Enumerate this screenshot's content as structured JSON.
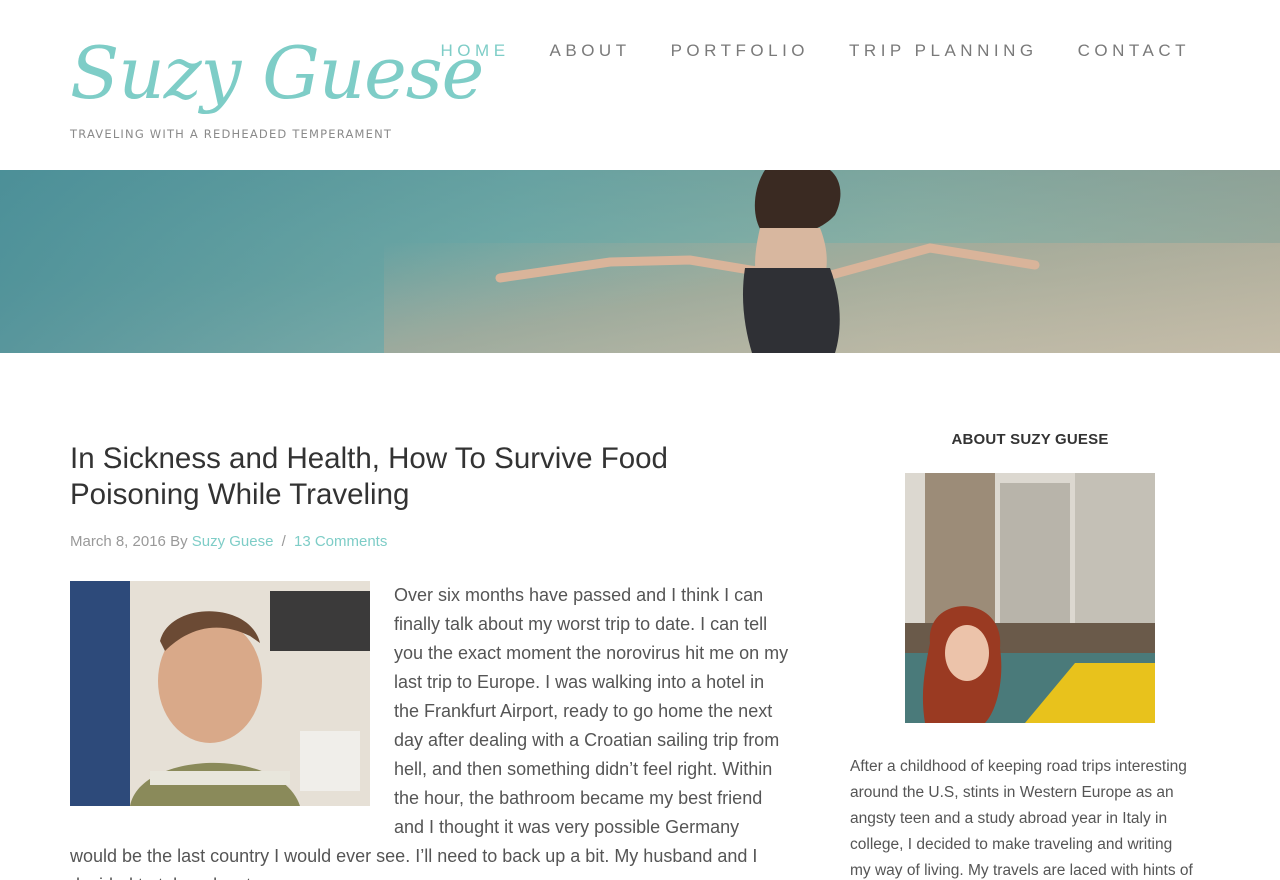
{
  "site": {
    "title": "Suzy Guese",
    "tagline": "TRAVELING WITH A REDHEADED TEMPERAMENT",
    "accent_color": "#7ecdc7"
  },
  "nav": {
    "items": [
      {
        "label": "HOME",
        "active": true
      },
      {
        "label": "ABOUT",
        "active": false
      },
      {
        "label": "PORTFOLIO",
        "active": false
      },
      {
        "label": "TRIP PLANNING",
        "active": false
      },
      {
        "label": "CONTACT",
        "active": false
      }
    ]
  },
  "hero": {
    "icon": "woman-arms-outstretched-over-water-photo"
  },
  "post": {
    "title": "In Sickness and Health, How To Survive Food Poisoning While Traveling",
    "date": "March 8, 2016",
    "by": "By",
    "author": "Suzy Guese",
    "separator": "/",
    "comments": "13 Comments",
    "image": "man-sick-on-train-photo",
    "body": "Over six months have passed and I think I can finally talk about my worst trip to date. I can tell you the exact moment the norovirus hit me on my last trip to Europe. I was walking into a hotel in the Frankfurt Airport, ready to go home the next day after dealing with a Croatian sailing trip from hell, and then something didn’t feel right. Within the hour, the bathroom became my best friend and I thought it was very possible Germany would be the last country I would ever see. I’ll need to back up a bit. My husband and I decided to take advantage"
  },
  "sidebar": {
    "widget_title": "ABOUT SUZY GUESE",
    "image": "redhead-woman-chicago-river-photo",
    "text": "After a childhood of keeping road trips interesting around the U.S, stints in Western Europe as an angsty teen and a study abroad year in Italy in college, I decided to make traveling and writing my way of living. My travels are laced with hints of a"
  }
}
